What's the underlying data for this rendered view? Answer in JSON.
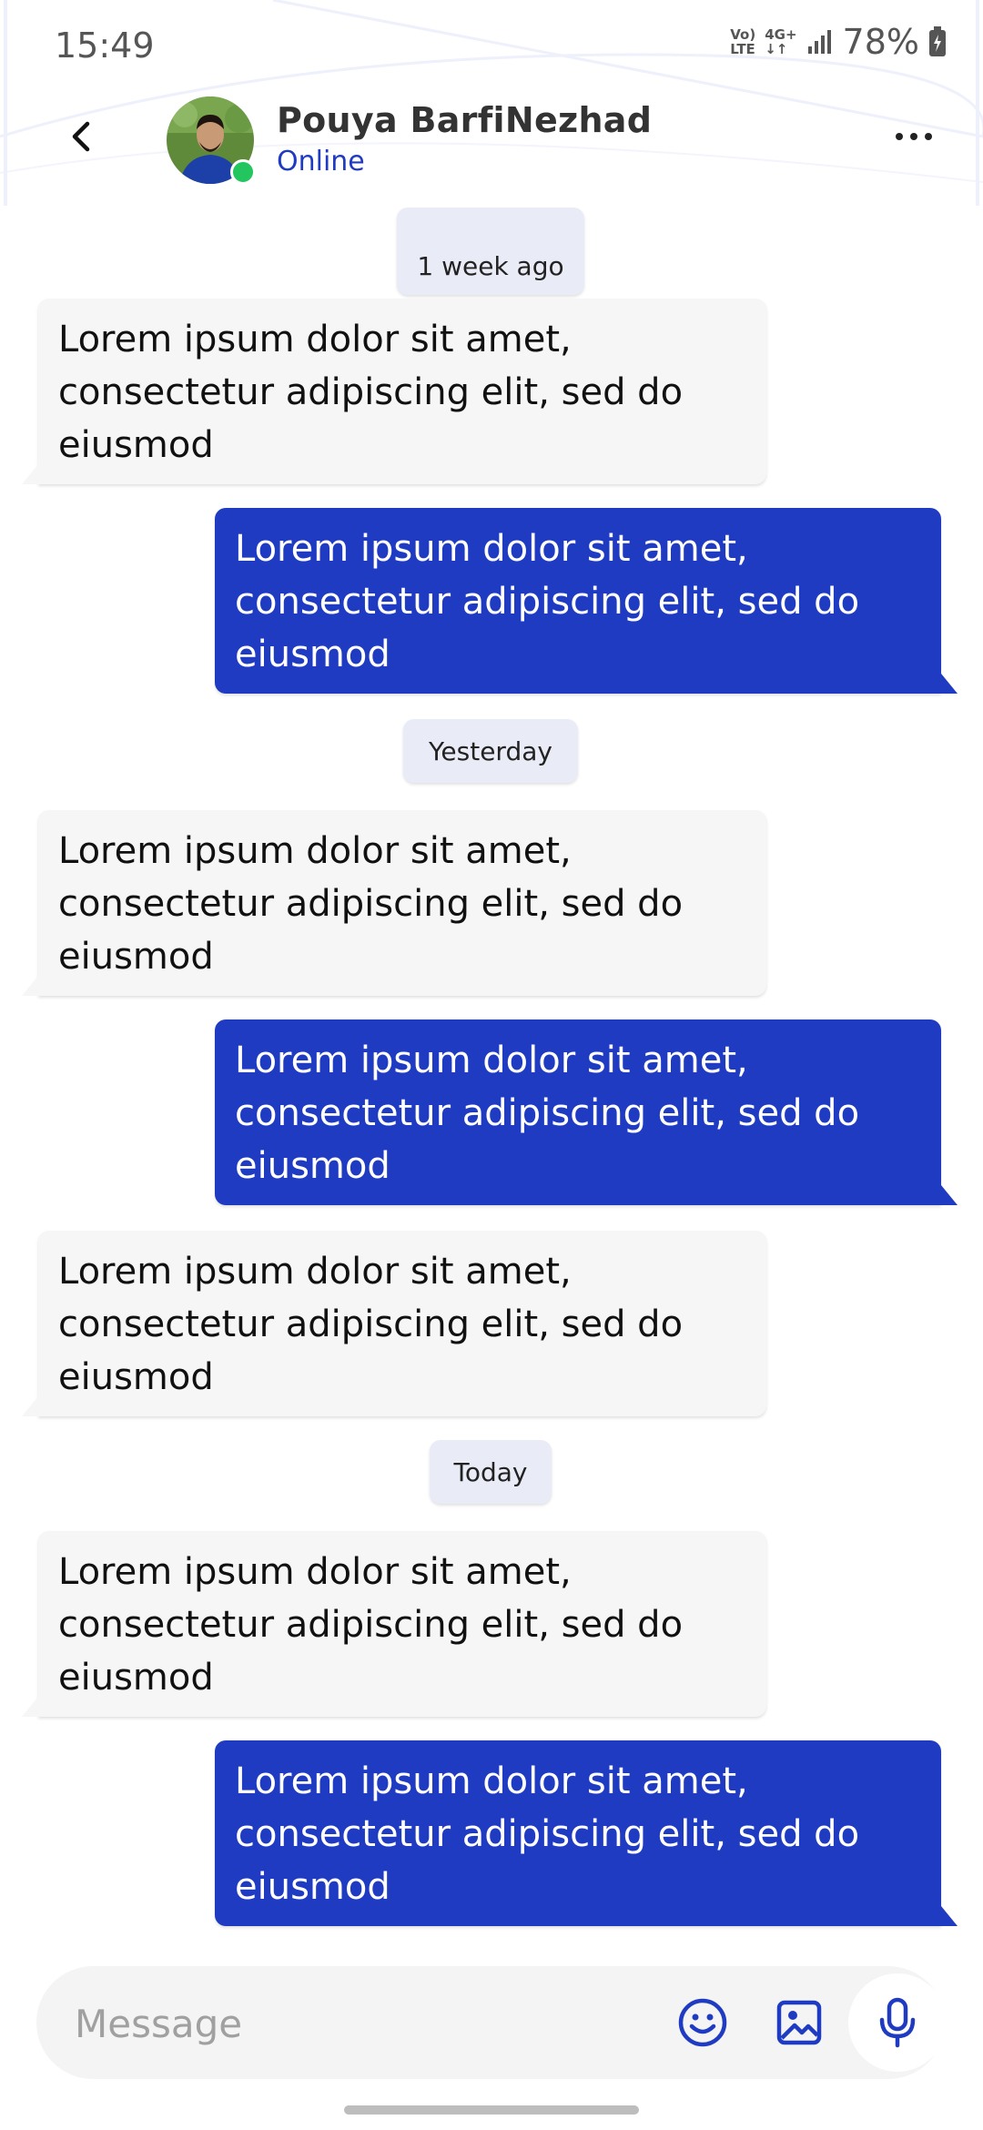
{
  "status_bar": {
    "time": "15:49",
    "network_top": "Vo)",
    "network_bottom": "LTE",
    "data_top": "4G+",
    "battery": "78%"
  },
  "header": {
    "contact_name": "Pouya BarfiNezhad",
    "contact_status": "Online"
  },
  "messages": [
    {
      "type": "date",
      "label": "1 week ago"
    },
    {
      "type": "received",
      "text": "Lorem ipsum dolor sit amet, consectetur adipiscing elit, sed do eiusmod"
    },
    {
      "type": "sent",
      "text": "Lorem ipsum dolor sit amet, consectetur adipiscing elit, sed do eiusmod"
    },
    {
      "type": "date",
      "label": "Yesterday"
    },
    {
      "type": "received",
      "text": "Lorem ipsum dolor sit amet, consectetur adipiscing elit, sed do eiusmod"
    },
    {
      "type": "sent",
      "text": "Lorem ipsum dolor sit amet, consectetur adipiscing elit, sed do eiusmod"
    },
    {
      "type": "received",
      "text": "Lorem ipsum dolor sit amet, consectetur adipiscing elit, sed do eiusmod"
    },
    {
      "type": "date",
      "label": "Today"
    },
    {
      "type": "received",
      "text": "Lorem ipsum dolor sit amet, consectetur adipiscing elit, sed do eiusmod"
    },
    {
      "type": "sent",
      "text": "Lorem ipsum dolor sit amet, consectetur adipiscing elit, sed do eiusmod"
    }
  ],
  "composer": {
    "placeholder": "Message",
    "value": ""
  },
  "colors": {
    "accent": "#1f3bc2",
    "received_bubble": "#f6f6f6",
    "date_pill": "#e9ecf7",
    "online": "#22c55e"
  },
  "icons": {
    "back": "back-arrow-icon",
    "more": "more-dots-icon",
    "emoji": "emoji-smile-icon",
    "gallery": "gallery-image-icon",
    "mic": "microphone-icon"
  }
}
